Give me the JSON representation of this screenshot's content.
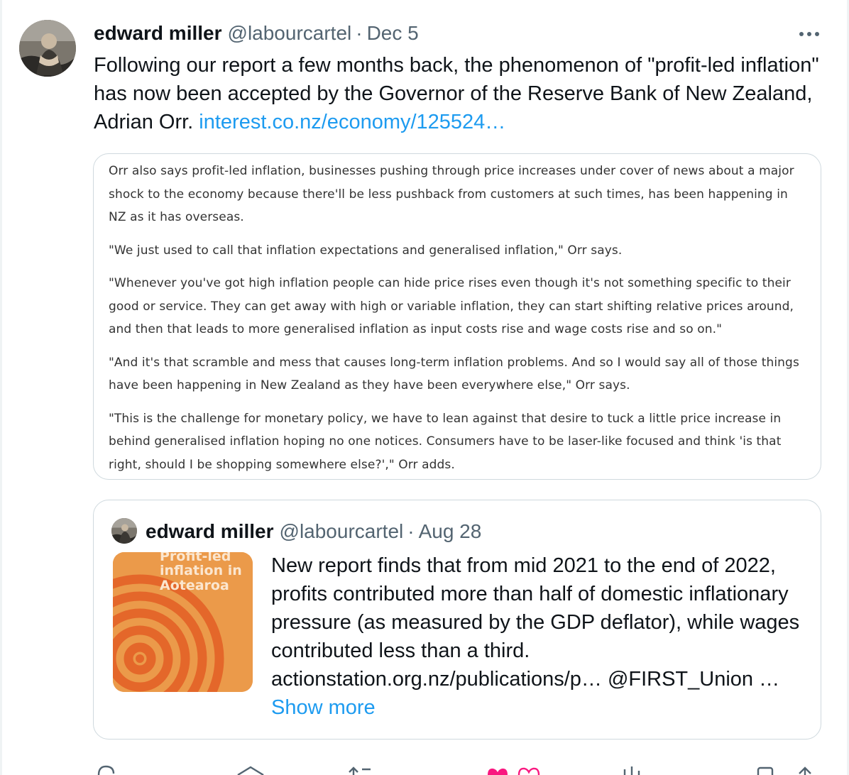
{
  "tweet": {
    "display_name": "edward miller",
    "handle": "@labourcartel",
    "separator": "·",
    "date": "Dec 5",
    "text_before_link": "Following our report a few months back, the phenomenon of \"profit-led inflation\" has now been accepted by the Governor of the Reserve Bank of New Zealand, Adrian Orr. ",
    "link_text": "interest.co.nz/economy/125524…"
  },
  "quote_image": {
    "paragraphs": [
      "Orr also says profit-led inflation, businesses pushing through price increases under cover of news about a major shock to the economy because there'll be less pushback from customers at such times, has been happening in NZ as it has overseas.",
      "\"We just used to call that inflation expectations and generalised inflation,\" Orr says.",
      "\"Whenever you've got high inflation people can hide price rises even though it's not something specific to their good or service. They can get away with high or variable inflation, they can start shifting relative prices around, and then that leads to more generalised inflation as input costs rise and wage costs rise and so on.\"",
      "\"And it's that scramble and mess that causes long-term inflation problems. And so I would say all of those things have been happening in New Zealand as they have been everywhere else,\" Orr says.",
      "\"This is the challenge for monetary policy, we have to lean against that desire to tuck a little price increase in behind generalised inflation hoping no one notices. Consumers have to be laser-like focused and think 'is that right, should I be shopping somewhere else?',\" Orr adds."
    ]
  },
  "quoted_tweet": {
    "display_name": "edward miller",
    "handle": "@labourcartel",
    "separator": "·",
    "date": "Aug 28",
    "text": "New report finds that from mid 2021 to the end of 2022, profits contributed more than half of domestic inflationary pressure (as measured by the GDP deflator), while wages contributed less than a third.",
    "links_line": "actionstation.org.nz/publications/p… @FIRST_Union …",
    "show_more": "Show more",
    "thumbnail": {
      "line1": "Profit-led",
      "line2": "inflation in",
      "line3": "Aotearoa"
    }
  },
  "colors": {
    "link": "#1d9bf0",
    "secondary_text": "#536471",
    "border": "#cfd9de",
    "like": "#f91880",
    "thumbnail_bg": "#eb9a4a",
    "thumbnail_rings": "#e4672a"
  },
  "icons": [
    "more-icon",
    "reply-icon",
    "bookmark-icon",
    "retweet-icon",
    "like-icon",
    "views-icon",
    "share-icon"
  ]
}
